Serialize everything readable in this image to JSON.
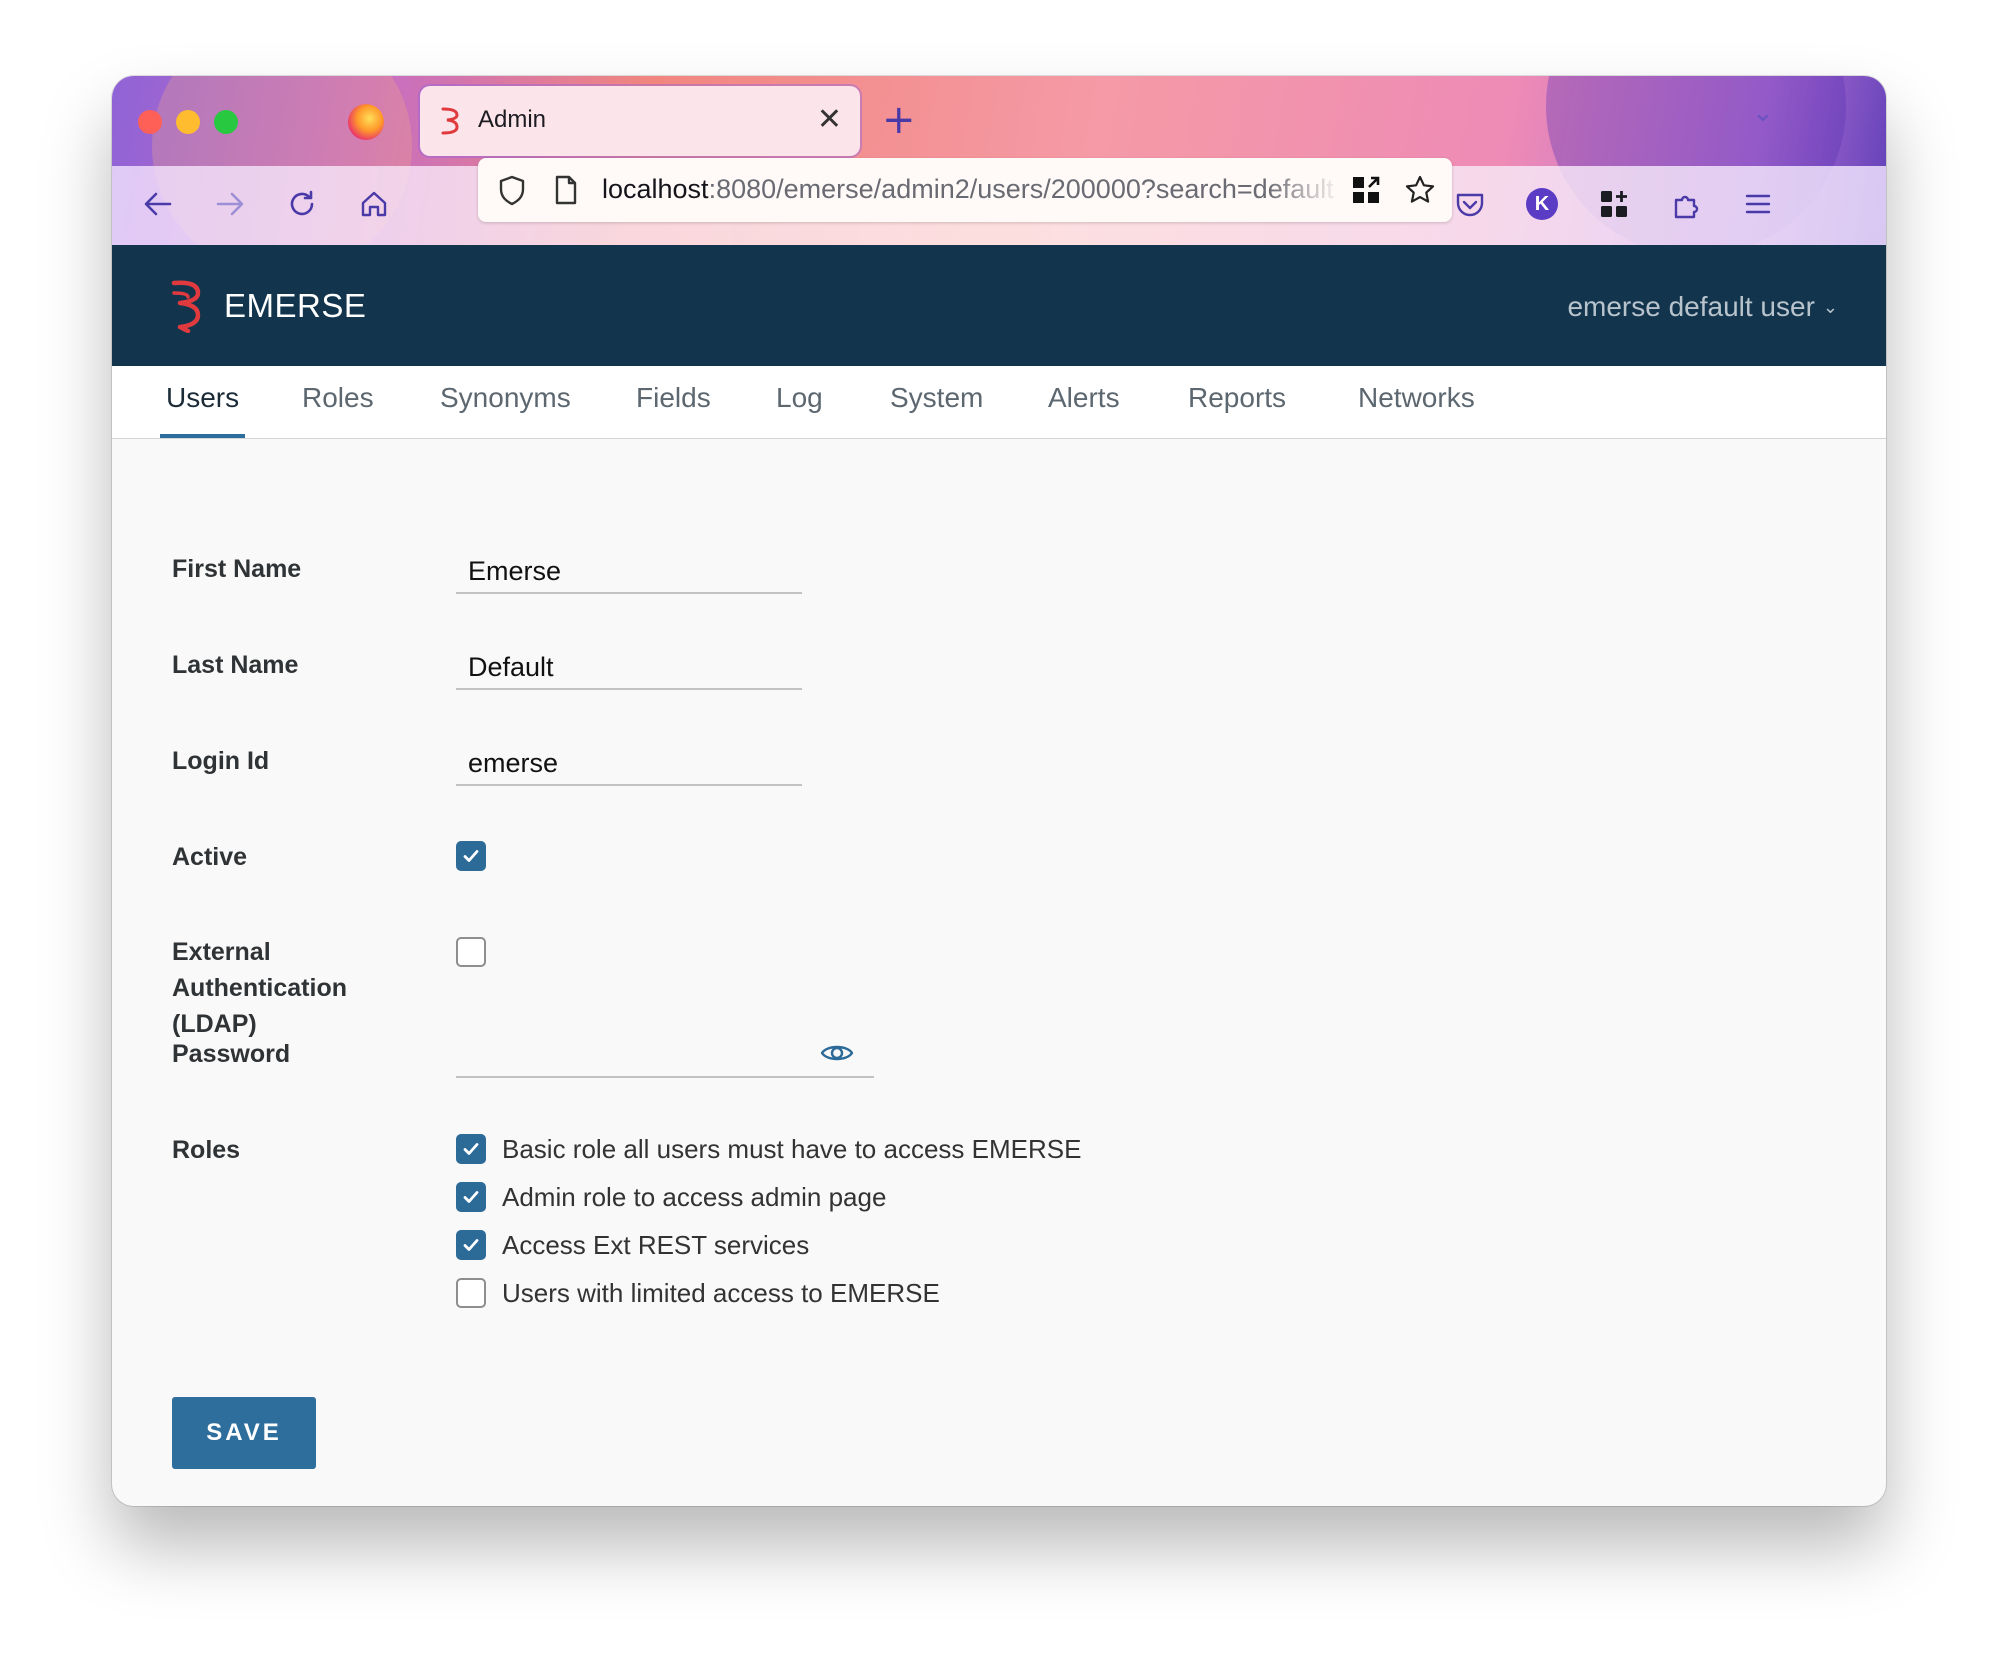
{
  "browser": {
    "tab_title": "Admin",
    "url_host": "localhost",
    "url_rest": ":8080/emerse/admin2/users/200000?search=default"
  },
  "app": {
    "brand": "EMERSE",
    "user_menu_label": "emerse default user"
  },
  "tabs": [
    "Users",
    "Roles",
    "Synonyms",
    "Fields",
    "Log",
    "System",
    "Alerts",
    "Reports",
    "Networks"
  ],
  "active_tab": "Users",
  "form": {
    "first_name": {
      "label": "First Name",
      "value": "Emerse"
    },
    "last_name": {
      "label": "Last Name",
      "value": "Default"
    },
    "login_id": {
      "label": "Login Id",
      "value": "emerse"
    },
    "active": {
      "label": "Active",
      "checked": true
    },
    "external_auth": {
      "label_line1": "External",
      "label_line2": "Authentication",
      "label_line3": "(LDAP)",
      "checked": false
    },
    "password": {
      "label": "Password",
      "value": ""
    },
    "roles": {
      "label": "Roles",
      "items": [
        {
          "label": "Basic role all users must have to access EMERSE",
          "checked": true
        },
        {
          "label": "Admin role to access admin page",
          "checked": true
        },
        {
          "label": "Access Ext REST services",
          "checked": true
        },
        {
          "label": "Users with limited access to EMERSE",
          "checked": false
        }
      ]
    },
    "save_label": "SAVE"
  },
  "colors": {
    "header_bg": "#12354d",
    "accent": "#2d6e9d",
    "logo_red": "#e03a3e"
  }
}
